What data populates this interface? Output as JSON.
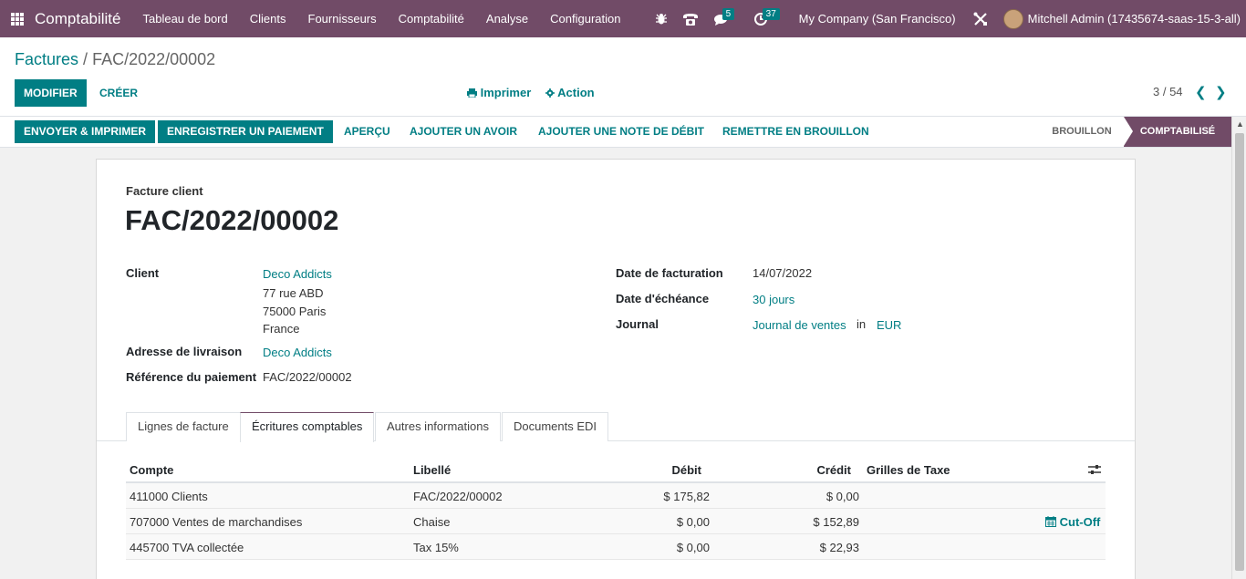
{
  "navbar": {
    "app_name": "Comptabilité",
    "menu": [
      "Tableau de bord",
      "Clients",
      "Fournisseurs",
      "Comptabilité",
      "Analyse",
      "Configuration"
    ],
    "messages_count": "5",
    "activities_count": "37",
    "company": "My Company (San Francisco)",
    "user": "Mitchell Admin (17435674-saas-15-3-all)"
  },
  "breadcrumb": {
    "parent": "Factures",
    "separator": "/",
    "current": "FAC/2022/00002"
  },
  "control": {
    "edit_label": "MODIFIER",
    "create_label": "CRÉER",
    "print_label": "Imprimer",
    "action_label": "Action",
    "pager": "3 / 54"
  },
  "statusbar": {
    "buttons": [
      "ENVOYER & IMPRIMER",
      "ENREGISTRER UN PAIEMENT",
      "APERÇU",
      "AJOUTER UN AVOIR",
      "AJOUTER UNE NOTE DE DÉBIT",
      "REMETTRE EN BROUILLON"
    ],
    "stages": {
      "draft": "BROUILLON",
      "posted": "COMPTABILISÉ"
    }
  },
  "invoice": {
    "type": "Facture client",
    "name": "FAC/2022/00002",
    "client_label": "Client",
    "client_name": "Deco Addicts",
    "address1": "77 rue ABD",
    "address2": "75000 Paris",
    "country": "France",
    "shipping_label": "Adresse de livraison",
    "shipping_value": "Deco Addicts",
    "payment_ref_label": "Référence du paiement",
    "payment_ref_value": "FAC/2022/00002",
    "invoice_date_label": "Date de facturation",
    "invoice_date": "14/07/2022",
    "due_date_label": "Date d'échéance",
    "due_date": "30 jours",
    "journal_label": "Journal",
    "journal": "Journal de ventes",
    "in_label": "in",
    "currency": "EUR"
  },
  "tabs": [
    "Lignes de facture",
    "Écritures comptables",
    "Autres informations",
    "Documents EDI"
  ],
  "table": {
    "headers": {
      "account": "Compte",
      "label": "Libellé",
      "debit": "Débit",
      "credit": "Crédit",
      "tax": "Grilles de Taxe"
    },
    "rows": [
      {
        "account": "411000 Clients",
        "label": "FAC/2022/00002",
        "debit": "$ 175,82",
        "credit": "$ 0,00"
      },
      {
        "account": "707000 Ventes de marchandises",
        "label": "Chaise",
        "debit": "$ 0,00",
        "credit": "$ 152,89",
        "cutoff": "Cut-Off"
      },
      {
        "account": "445700 TVA collectée",
        "label": "Tax 15%",
        "debit": "$ 0,00",
        "credit": "$ 22,93"
      }
    ]
  },
  "colors": {
    "brand": "#714B67",
    "accent": "#017E84"
  }
}
